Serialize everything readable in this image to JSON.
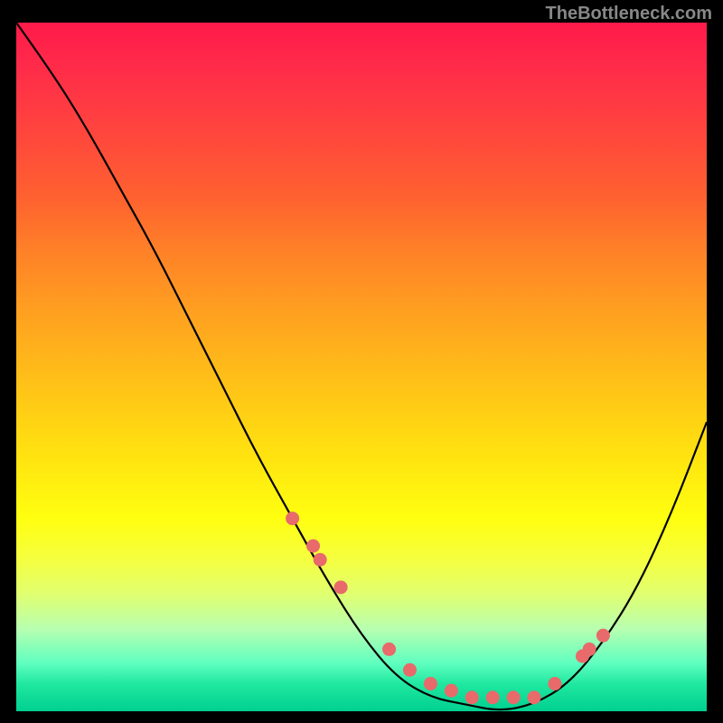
{
  "watermark": "TheBottleneck.com",
  "chart_data": {
    "type": "line",
    "title": "",
    "xlabel": "",
    "ylabel": "",
    "xlim": [
      0,
      1
    ],
    "ylim": [
      0,
      1
    ],
    "series": [
      {
        "name": "curve",
        "x": [
          0.0,
          0.05,
          0.1,
          0.15,
          0.2,
          0.25,
          0.3,
          0.35,
          0.4,
          0.45,
          0.5,
          0.55,
          0.6,
          0.65,
          0.7,
          0.75,
          0.8,
          0.85,
          0.9,
          0.95,
          1.0
        ],
        "y": [
          1.0,
          0.93,
          0.85,
          0.76,
          0.67,
          0.57,
          0.47,
          0.37,
          0.28,
          0.19,
          0.11,
          0.05,
          0.02,
          0.01,
          0.0,
          0.01,
          0.04,
          0.1,
          0.18,
          0.29,
          0.42
        ]
      }
    ],
    "markers": {
      "name": "dots",
      "color": "#e86a6a",
      "x": [
        0.4,
        0.43,
        0.44,
        0.47,
        0.54,
        0.57,
        0.6,
        0.63,
        0.66,
        0.69,
        0.72,
        0.75,
        0.78,
        0.82,
        0.83,
        0.85
      ],
      "y": [
        0.28,
        0.24,
        0.22,
        0.18,
        0.09,
        0.06,
        0.04,
        0.03,
        0.02,
        0.02,
        0.02,
        0.02,
        0.04,
        0.08,
        0.09,
        0.11
      ]
    },
    "gradient_stops": [
      {
        "pos": 0.0,
        "color": "#ff1a4a"
      },
      {
        "pos": 0.5,
        "color": "#ffc018"
      },
      {
        "pos": 0.75,
        "color": "#ffff10"
      },
      {
        "pos": 1.0,
        "color": "#00d090"
      }
    ]
  }
}
